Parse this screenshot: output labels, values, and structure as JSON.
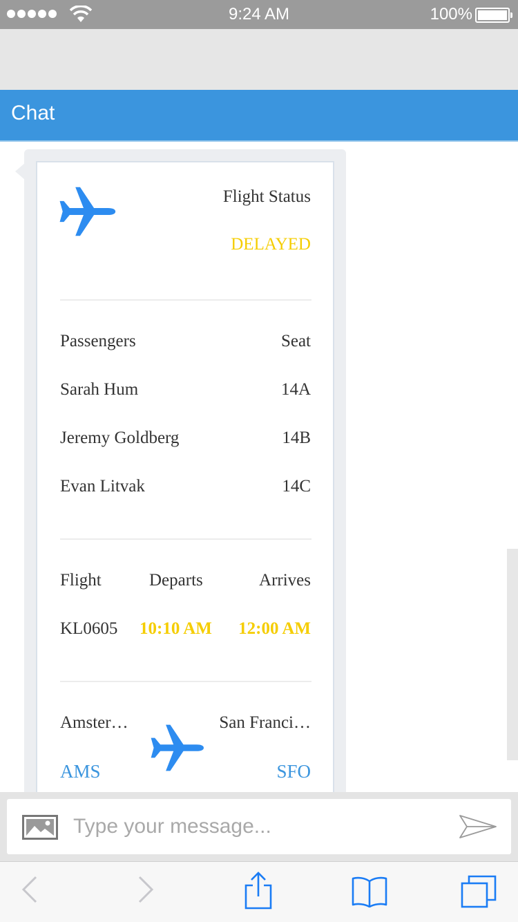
{
  "status_bar": {
    "time": "9:24 AM",
    "battery": "100%"
  },
  "header": {
    "title": "Chat"
  },
  "flight_card": {
    "status_label": "Flight Status",
    "status_value": "DELAYED",
    "passengers_header": "Passengers",
    "seat_header": "Seat",
    "passengers": [
      {
        "name": "Sarah Hum",
        "seat": "14A"
      },
      {
        "name": "Jeremy Goldberg",
        "seat": "14B"
      },
      {
        "name": "Evan Litvak",
        "seat": "14C"
      }
    ],
    "flight_header": "Flight",
    "departs_header": "Departs",
    "arrives_header": "Arrives",
    "flight_number": "KL0605",
    "departs_time": "10:10 AM",
    "arrives_time": "12:00 AM",
    "origin_city": "Amster…",
    "destination_city": "San Franci…",
    "origin_code": "AMS",
    "destination_code": "SFO"
  },
  "composer": {
    "placeholder": "Type your message..."
  },
  "icons": {
    "plane": "airplane-icon",
    "image": "image-icon",
    "send": "send-icon",
    "back": "chevron-left-icon",
    "forward": "chevron-right-icon",
    "share": "share-icon",
    "bookmarks": "book-icon",
    "tabs": "tabs-icon"
  },
  "colors": {
    "header": "#3b95de",
    "accent_yellow": "#f5cd00",
    "accent_blue": "#3b95de",
    "icon_blue": "#2d8cf0"
  }
}
